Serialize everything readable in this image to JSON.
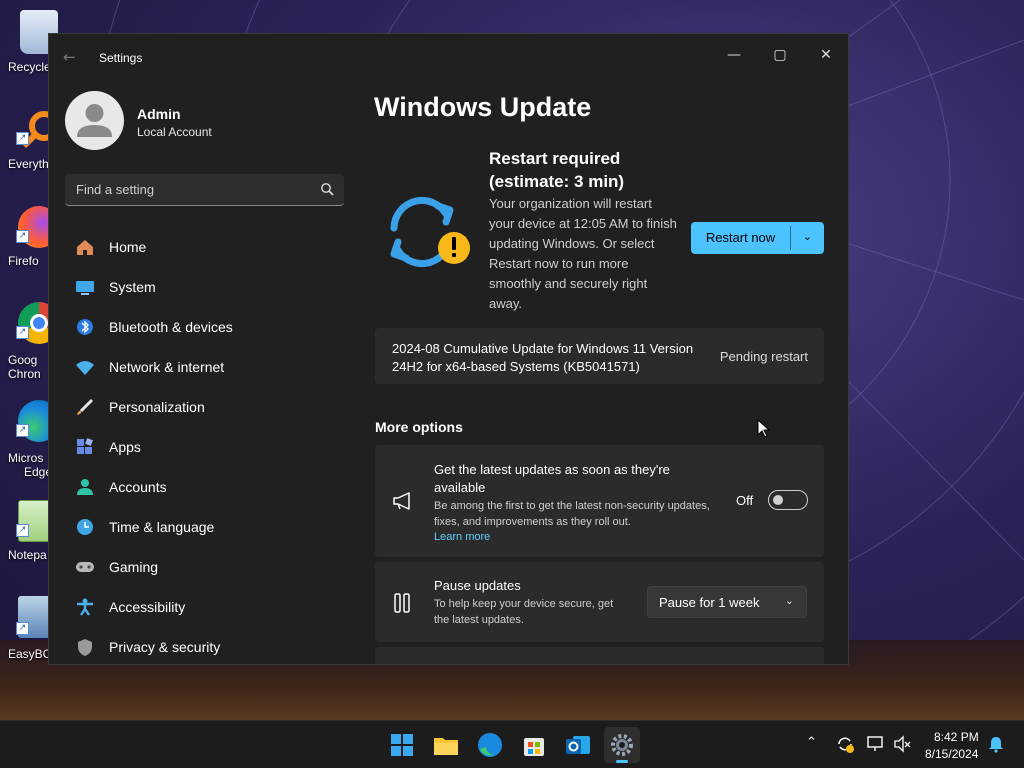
{
  "desktop": {
    "icons": [
      {
        "label": "Recycle"
      },
      {
        "label": "Everyth"
      },
      {
        "label": "Firefo"
      },
      {
        "label": "Goog",
        "label2": "Chron"
      },
      {
        "label": "Micros",
        "label2": "Edge"
      },
      {
        "label": "Notepa"
      },
      {
        "label": "EasyBCI"
      }
    ]
  },
  "window": {
    "title": "Settings",
    "minimize_icon": "—",
    "maximize_icon": "▢",
    "close_icon": "✕"
  },
  "sidebar": {
    "profile": {
      "name": "Admin",
      "account": "Local Account"
    },
    "search": {
      "placeholder": "Find a setting"
    },
    "items": [
      {
        "label": "Home"
      },
      {
        "label": "System"
      },
      {
        "label": "Bluetooth & devices"
      },
      {
        "label": "Network & internet"
      },
      {
        "label": "Personalization"
      },
      {
        "label": "Apps"
      },
      {
        "label": "Accounts"
      },
      {
        "label": "Time & language"
      },
      {
        "label": "Gaming"
      },
      {
        "label": "Accessibility"
      },
      {
        "label": "Privacy & security"
      }
    ]
  },
  "main": {
    "title": "Windows Update",
    "status": {
      "heading": "Restart required (estimate: 3 min)",
      "description": "Your organization will restart your device at 12:05 AM to finish updating Windows. Or select Restart now to run more smoothly and securely right away.",
      "restart_label": "Restart now",
      "dropdown_icon": "⌄"
    },
    "pending_update": {
      "name": "2024-08 Cumulative Update for Windows 11 Version 24H2 for x64-based Systems (KB5041571)",
      "status": "Pending restart"
    },
    "more_options_heading": "More options",
    "options": {
      "latest_updates": {
        "title": "Get the latest updates as soon as they're available",
        "description": "Be among the first to get the latest non-security updates, fixes, and improvements as they roll out.",
        "link": "Learn more",
        "toggle_label": "Off",
        "toggle_on": false
      },
      "pause_updates": {
        "title": "Pause updates",
        "description": "To help keep your device secure, get the latest updates.",
        "selected": "Pause for 1 week",
        "chevron": "⌄"
      }
    }
  },
  "taskbar": {
    "clock_time": "8:42 PM",
    "clock_date": "8/15/2024",
    "accent": "#4cc2ff"
  }
}
